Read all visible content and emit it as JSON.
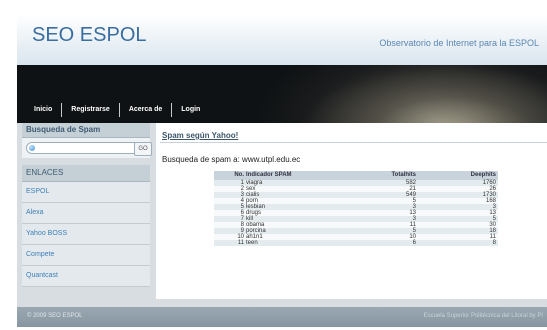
{
  "header": {
    "site_title": "SEO ESPOL",
    "tagline": "Observatorio de Internet para la ESPOL"
  },
  "nav": {
    "items": [
      {
        "label": "Inicio"
      },
      {
        "label": "Registrarse"
      },
      {
        "label": "Acerca de"
      },
      {
        "label": "Login"
      }
    ]
  },
  "sidebar": {
    "spam_search_title": "Busqueda de Spam",
    "search": {
      "value": "",
      "placeholder": ""
    },
    "go_label": "GO",
    "links_title": "ENLACES",
    "links": [
      {
        "label": "ESPOL"
      },
      {
        "label": "Alexa"
      },
      {
        "label": "Yahoo BOSS"
      },
      {
        "label": "Compete"
      },
      {
        "label": "Quantcast"
      }
    ]
  },
  "main": {
    "heading": "Spam según Yahoo!",
    "search_result": "Busqueda de spam a: www.utpl.edu.ec",
    "table": {
      "headers": [
        "No.",
        "Indicador SPAM",
        "Totalhits",
        "Deephits"
      ],
      "rows": [
        [
          "1",
          "viagra",
          "582",
          "1760"
        ],
        [
          "2",
          "sex",
          "21",
          "26"
        ],
        [
          "3",
          "cialis",
          "549",
          "1730"
        ],
        [
          "4",
          "porn",
          "5",
          "168"
        ],
        [
          "5",
          "lesbian",
          "3",
          "3"
        ],
        [
          "6",
          "drugs",
          "13",
          "13"
        ],
        [
          "7",
          "kill",
          "3",
          "5"
        ],
        [
          "8",
          "obama",
          "11",
          "30"
        ],
        [
          "9",
          "porcina",
          "5",
          "18"
        ],
        [
          "10",
          "ah1n1",
          "10",
          "11"
        ],
        [
          "11",
          "teen",
          "6",
          "8"
        ]
      ]
    }
  },
  "footer": {
    "copyright": "© 2009 SEO ESPOL",
    "school": "Escuela Superior Politécnica del Litoral by PI"
  }
}
